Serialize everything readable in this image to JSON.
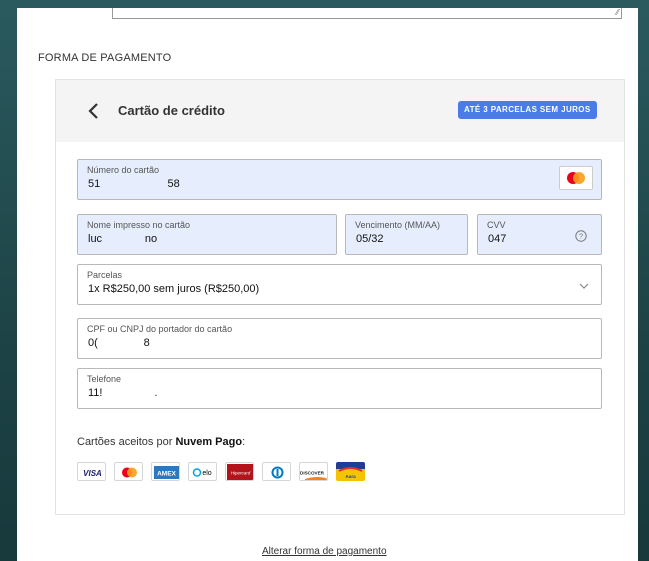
{
  "section_title": "FORMA DE PAGAMENTO",
  "payment_method": {
    "title": "Cartão de crédito",
    "promo_badge": "ATÉ 3 PARCELAS SEM JUROS"
  },
  "form": {
    "card_number": {
      "label": "Número do cartão",
      "value": "51                      58"
    },
    "card_name": {
      "label": "Nome impresso no cartão",
      "value": "luc              no"
    },
    "expiry": {
      "label": "Vencimento (MM/AA)",
      "value": "05/32"
    },
    "cvv": {
      "label": "CVV",
      "value": "047"
    },
    "installments": {
      "label": "Parcelas",
      "value": "1x R$250,00 sem juros (R$250,00)"
    },
    "document": {
      "label": "CPF ou CNPJ do portador do cartão",
      "value": "0(               8"
    },
    "phone": {
      "label": "Telefone",
      "value": "11!                 ."
    }
  },
  "accepted_cards": {
    "label_prefix": "Cartões aceitos por ",
    "label_brand": "Nuvem Pago",
    "label_suffix": ":",
    "brands": [
      "visa",
      "mastercard",
      "amex",
      "elo",
      "hipercard",
      "diners",
      "discover",
      "aura"
    ],
    "brand_texts": {
      "visa": "VISA",
      "amex": "AMEX",
      "elo": "elo",
      "hipercard": "Hipercard",
      "discover": "DISCOVER",
      "aura": "Aura"
    }
  },
  "footer": {
    "change_payment_link": "Alterar forma de pagamento"
  },
  "colors": {
    "accent": "#4a7be8",
    "field_filled_bg": "#e6eefe",
    "background": "#1e4a4e"
  }
}
